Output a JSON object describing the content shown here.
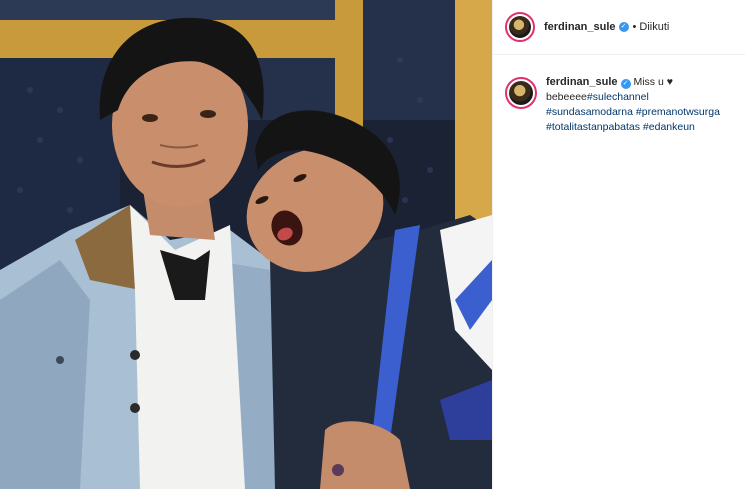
{
  "post": {
    "author": {
      "username": "ferdinan_sule",
      "verified": true,
      "follow_status": "Diikuti",
      "separator": "•"
    },
    "caption": {
      "username": "ferdinan_sule",
      "line1_text": "Miss u ♥",
      "line2_text": "bebeeee",
      "hashtags": [
        "#sulechannel",
        "#sundasamodarna",
        "#premanotwsurga",
        "#totalitastanpabatas",
        "#edankeun"
      ]
    }
  },
  "icons": {
    "verified": "verified-badge-icon"
  },
  "colors": {
    "accent_link": "#00376b",
    "verified_blue": "#3897f0",
    "text": "#262626",
    "story_ring": "#e1306c"
  }
}
